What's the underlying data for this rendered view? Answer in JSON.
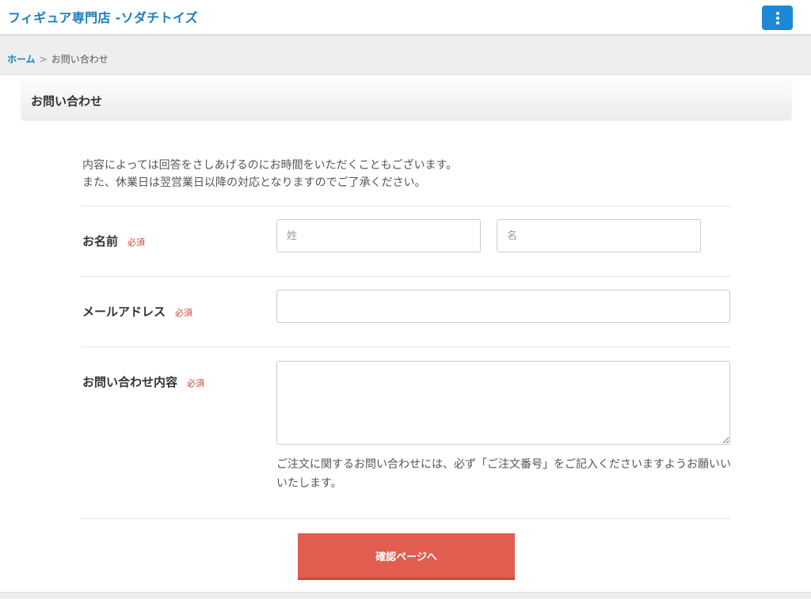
{
  "header": {
    "site_title": "フィギュア専門店 -ソダチトイズ",
    "menu_icon": "vertical-dots-icon",
    "accent_color": "#1e88d6"
  },
  "breadcrumb": {
    "home": "ホーム",
    "separator": ">",
    "current": "お問い合わせ"
  },
  "page": {
    "title": "お問い合わせ",
    "intro_line1": "内容によっては回答をさしあげるのにお時間をいただくこともございます。",
    "intro_line2": "また、休業日は翌営業日以降の対応となりますのでご了承ください。"
  },
  "form": {
    "required_badge": "必須",
    "name": {
      "label": "お名前",
      "last_placeholder": "姓",
      "first_placeholder": "名"
    },
    "email": {
      "label": "メールアドレス",
      "placeholder": ""
    },
    "message": {
      "label": "お問い合わせ内容",
      "note": "ご注文に関するお問い合わせには、必ず「ご注文番号」をご記入くださいますようお願いいいたします。"
    },
    "submit_label": "確認ページへ",
    "submit_color": "#e05d50",
    "required_color": "#c9453a"
  }
}
